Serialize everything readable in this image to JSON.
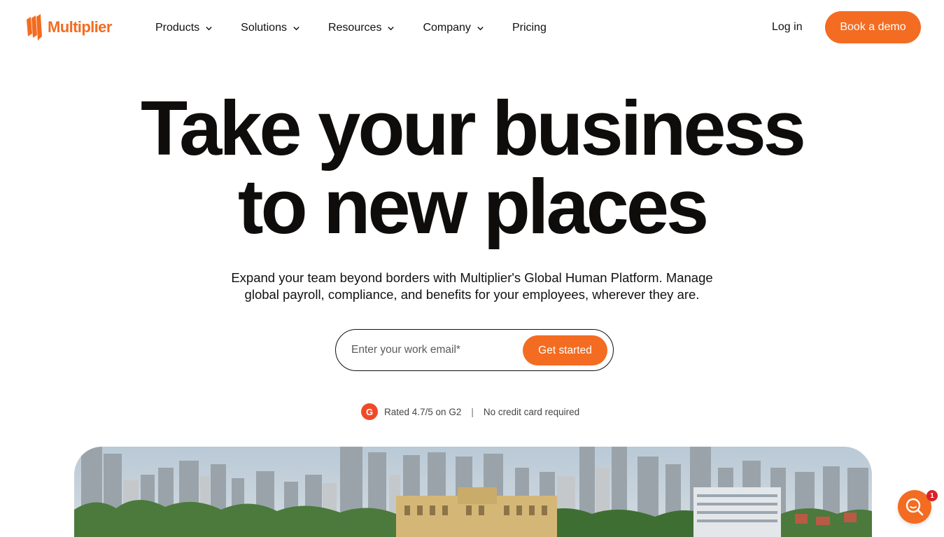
{
  "brand": {
    "name": "Multiplier",
    "accent_color": "#f36c21"
  },
  "nav": {
    "items": [
      {
        "label": "Products",
        "has_dropdown": true
      },
      {
        "label": "Solutions",
        "has_dropdown": true
      },
      {
        "label": "Resources",
        "has_dropdown": true
      },
      {
        "label": "Company",
        "has_dropdown": true
      },
      {
        "label": "Pricing",
        "has_dropdown": false
      }
    ],
    "login_label": "Log in",
    "demo_label": "Book a demo"
  },
  "hero": {
    "title_line1": "Take your business",
    "title_line2": "to new places",
    "subtitle_line1": "Expand your team beyond borders with Multiplier's Global Human Platform. Manage",
    "subtitle_line2": "global payroll, compliance, and benefits for your employees, wherever they are.",
    "email_placeholder": "Enter your work email*",
    "cta_label": "Get started",
    "rating_text": "Rated 4.7/5 on G2",
    "separator": "|",
    "no_card_text": "No credit card required",
    "g2_icon": "g2-logo-icon"
  },
  "chat_widget": {
    "icon": "chat-search-icon",
    "badge_count": "1"
  }
}
